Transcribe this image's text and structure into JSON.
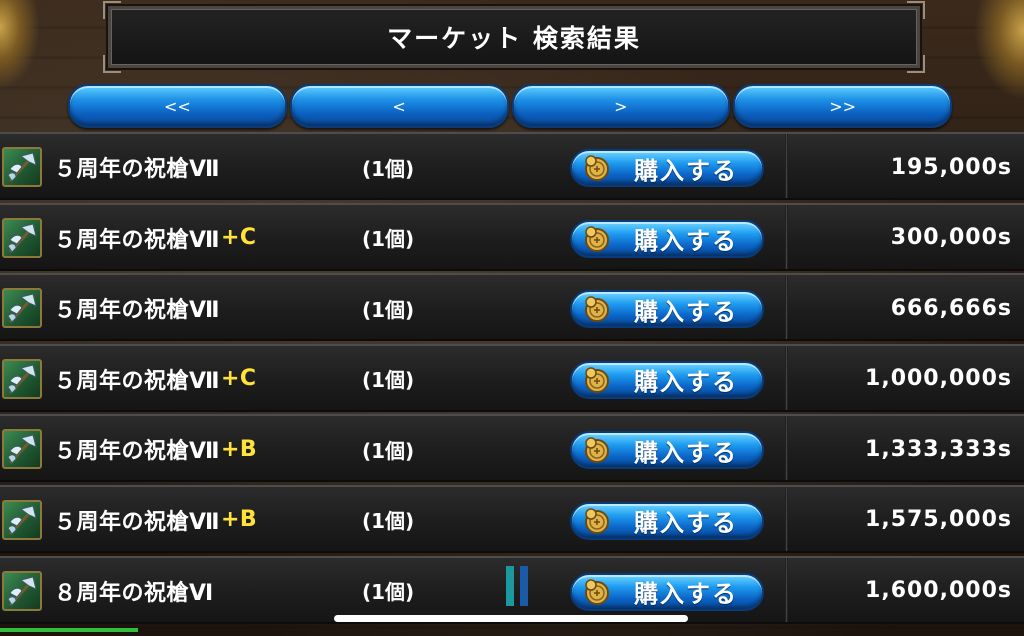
{
  "title": "マーケット 検索結果",
  "pager": {
    "first": "<<",
    "prev": "<",
    "next": ">",
    "last": ">>"
  },
  "buy_label": "購入する",
  "items": [
    {
      "name": "５周年の祝槍Ⅶ",
      "suffix": "",
      "qty": "(1個)",
      "price": "195,000s"
    },
    {
      "name": "５周年の祝槍Ⅶ",
      "suffix": "+C",
      "qty": "(1個)",
      "price": "300,000s"
    },
    {
      "name": "５周年の祝槍Ⅶ",
      "suffix": "",
      "qty": "(1個)",
      "price": "666,666s"
    },
    {
      "name": "５周年の祝槍Ⅶ",
      "suffix": "+C",
      "qty": "(1個)",
      "price": "1,000,000s"
    },
    {
      "name": "５周年の祝槍Ⅶ",
      "suffix": "+B",
      "qty": "(1個)",
      "price": "1,333,333s"
    },
    {
      "name": "５周年の祝槍Ⅶ",
      "suffix": "+B",
      "qty": "(1個)",
      "price": "1,575,000s"
    },
    {
      "name": "８周年の祝槍Ⅵ",
      "suffix": "",
      "qty": "(1個)",
      "price": "1,600,000s"
    }
  ],
  "icons": {
    "item": "spear-axe-icon",
    "coin": "coin-icon"
  },
  "colors": {
    "suffix": "#ffe23a",
    "button_blue": "#1e9bf0",
    "row_bg": "#1d1d1d"
  }
}
